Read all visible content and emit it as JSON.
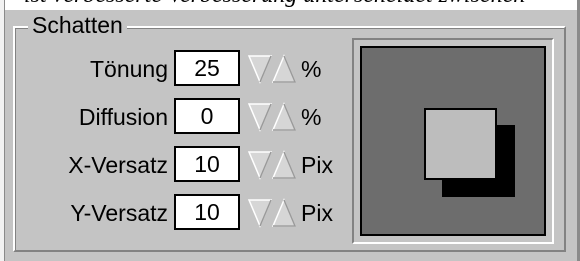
{
  "background_caption": "ist verbesserte Verbesserung unterscheidet zwischen",
  "group": {
    "title": "Schatten",
    "fields": [
      {
        "label": "Tönung",
        "value": "25",
        "unit": "%"
      },
      {
        "label": "Diffusion",
        "value": "0",
        "unit": "%"
      },
      {
        "label": "X-Versatz",
        "value": "10",
        "unit": "Pix"
      },
      {
        "label": "Y-Versatz",
        "value": "10",
        "unit": "Pix"
      }
    ]
  },
  "preview": {
    "background_color": "#6d6d6d",
    "box_color": "#bdbdbd",
    "shadow_color": "#000000"
  },
  "icons": {
    "stepper_down": "triangle-down-icon",
    "stepper_up": "triangle-up-icon"
  }
}
